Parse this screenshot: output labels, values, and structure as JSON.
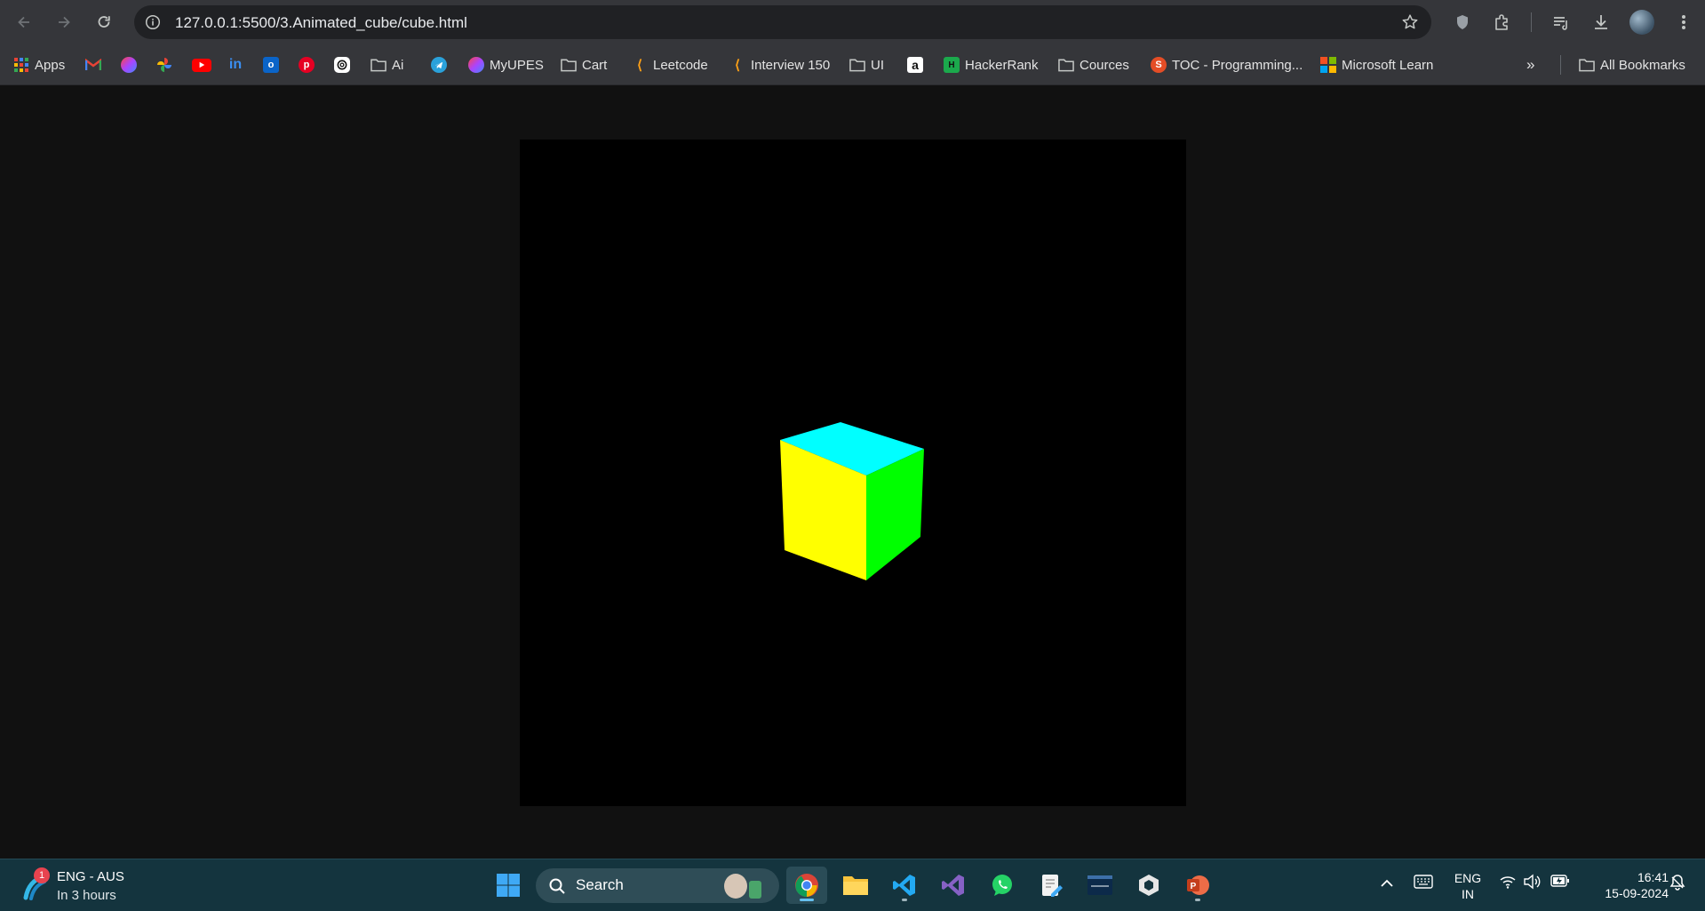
{
  "browser": {
    "url": "127.0.0.1:5500/3.Animated_cube/cube.html"
  },
  "bookmarks": [
    {
      "label": "Apps",
      "icon": "apps-grid-icon"
    },
    {
      "label": "",
      "icon": "gmail-icon"
    },
    {
      "label": "",
      "icon": "myupes-icon"
    },
    {
      "label": "",
      "icon": "google-photos-icon"
    },
    {
      "label": "",
      "icon": "youtube-icon"
    },
    {
      "label": "",
      "icon": "linkedin-icon"
    },
    {
      "label": "",
      "icon": "outlook-icon"
    },
    {
      "label": "",
      "icon": "pinterest-icon"
    },
    {
      "label": "",
      "icon": "chatgpt-icon"
    },
    {
      "label": "Ai",
      "icon": "folder-icon"
    },
    {
      "label": "",
      "icon": "telegram-icon"
    },
    {
      "label": "MyUPES",
      "icon": "myupes-icon"
    },
    {
      "label": "Cart",
      "icon": "folder-icon"
    },
    {
      "label": "Leetcode",
      "icon": "leetcode-icon"
    },
    {
      "label": "Interview 150",
      "icon": "leetcode-icon"
    },
    {
      "label": "UI",
      "icon": "folder-icon"
    },
    {
      "label": "",
      "icon": "amazon-icon"
    },
    {
      "label": "HackerRank",
      "icon": "hackerrank-icon"
    },
    {
      "label": "Cources",
      "icon": "folder-icon"
    },
    {
      "label": "TOC - Programming...",
      "icon": "toc-icon"
    },
    {
      "label": "Microsoft Learn",
      "icon": "microsoft-icon"
    }
  ],
  "bookmarks_all": "All Bookmarks",
  "taskbar": {
    "weather_badge": "1",
    "weather_title": "ENG - AUS",
    "weather_sub": "In 3 hours",
    "search_label": "Search",
    "lang_top": "ENG",
    "lang_bottom": "IN",
    "time": "16:41",
    "date": "15-09-2024"
  },
  "cube_colors": {
    "top": "#00ffff",
    "front": "#ffff00",
    "right": "#00ff00"
  }
}
